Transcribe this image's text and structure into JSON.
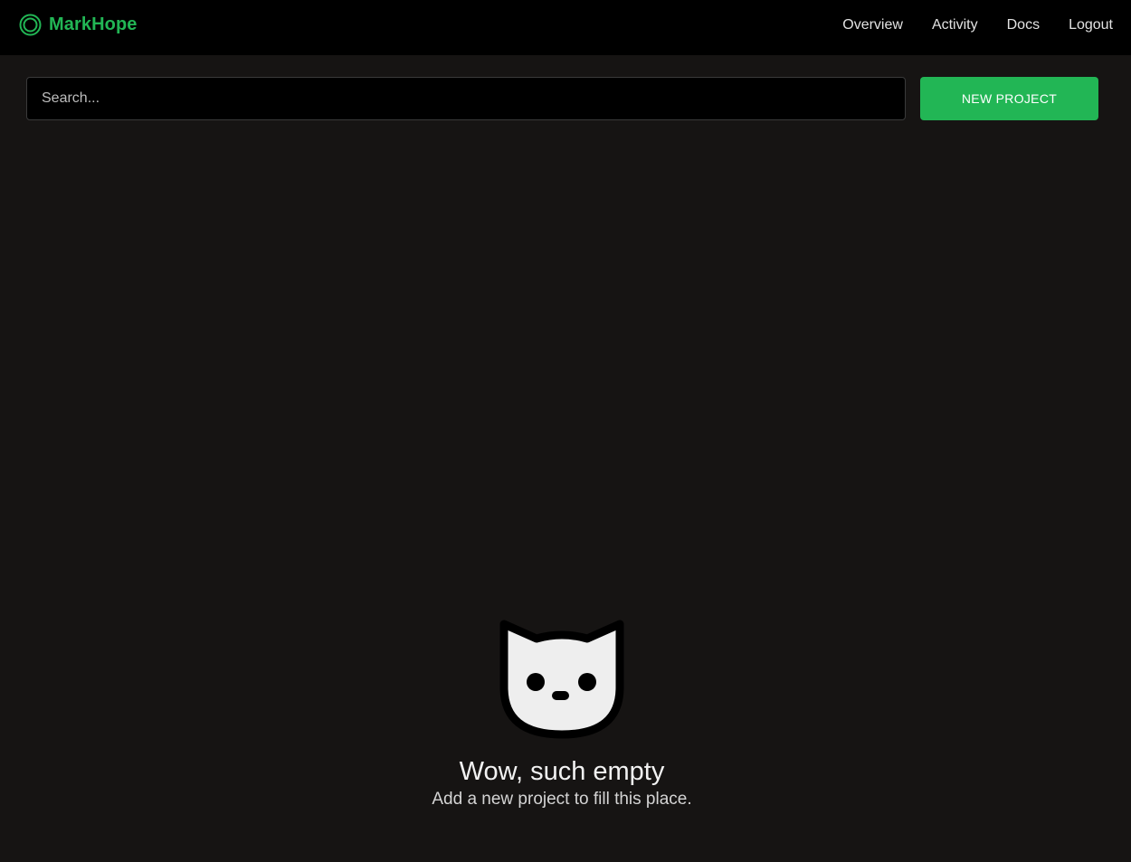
{
  "header": {
    "brand_name": "MarkHope",
    "brand_color": "#22b655",
    "logo_icon": "ring-logo-icon",
    "nav": [
      {
        "label": "Overview"
      },
      {
        "label": "Activity"
      },
      {
        "label": "Docs"
      },
      {
        "label": "Logout"
      }
    ]
  },
  "toolbar": {
    "search_placeholder": "Search...",
    "search_value": "",
    "new_project_label": "NEW PROJECT",
    "accent_color": "#22b655"
  },
  "empty_state": {
    "icon": "cat-face-icon",
    "title": "Wow, such empty",
    "subtitle": "Add a new project to fill this place."
  }
}
